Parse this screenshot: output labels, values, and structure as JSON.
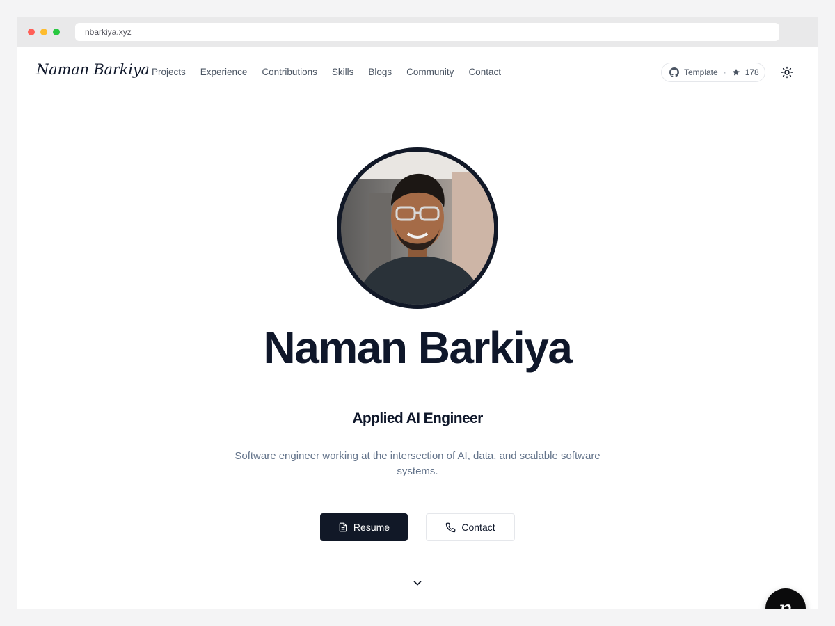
{
  "browser": {
    "url": "nbarkiya.xyz"
  },
  "nav": {
    "logo": "Naman Barkiya",
    "links": [
      "Projects",
      "Experience",
      "Contributions",
      "Skills",
      "Blogs",
      "Community",
      "Contact"
    ],
    "github": {
      "label": "Template",
      "separator": "·",
      "stars": "178",
      "icon": "github-icon"
    },
    "theme_icon": "sun-icon"
  },
  "hero": {
    "name": "Naman Barkiya",
    "role": "Applied AI Engineer",
    "bio": "Software engineer working at the intersection of AI, data, and scalable software systems.",
    "resume_label": "Resume",
    "contact_label": "Contact"
  },
  "fab": {
    "label": "n"
  },
  "colors": {
    "primary": "#111827",
    "text_muted": "#64748b",
    "accent_border": "#e5e7eb"
  }
}
